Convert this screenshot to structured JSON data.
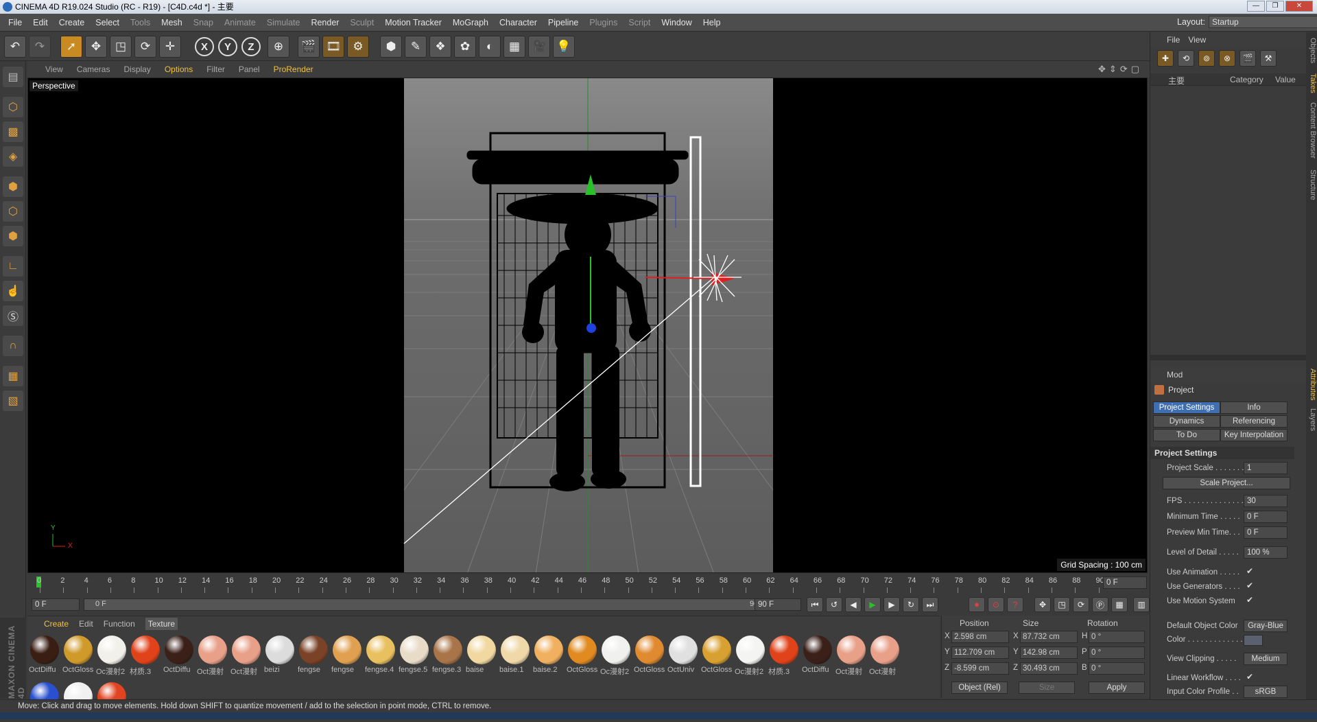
{
  "window": {
    "title": "CINEMA 4D R19.024 Studio (RC - R19) - [C4D.c4d *] - 主要",
    "buttons": [
      "—",
      "❐",
      "✕"
    ]
  },
  "menu": {
    "items": [
      "File",
      "Edit",
      "Create",
      "Select",
      "Tools",
      "Mesh",
      "Snap",
      "Animate",
      "Simulate",
      "Render",
      "Sculpt",
      "Motion Tracker",
      "MoGraph",
      "Character",
      "Pipeline",
      "Plugins",
      "Script",
      "Window",
      "Help"
    ],
    "layout_label": "Layout:",
    "layout_value": "Startup"
  },
  "viewport": {
    "menu": [
      "View",
      "Cameras",
      "Display",
      "Options",
      "Filter",
      "Panel",
      "ProRender"
    ],
    "name": "Perspective",
    "grid_spacing": "Grid Spacing : 100 cm",
    "icons": "✥⇕⟳▢",
    "axis_y": "Y",
    "axis_x": "X"
  },
  "timeline": {
    "ticks": [
      "0",
      "2",
      "4",
      "6",
      "8",
      "10",
      "12",
      "14",
      "16",
      "18",
      "20",
      "22",
      "24",
      "26",
      "28",
      "30",
      "32",
      "34",
      "36",
      "38",
      "40",
      "42",
      "44",
      "46",
      "48",
      "50",
      "52",
      "54",
      "56",
      "58",
      "60",
      "62",
      "64",
      "66",
      "68",
      "70",
      "72",
      "74",
      "76",
      "78",
      "80",
      "82",
      "84",
      "86",
      "88",
      "90"
    ],
    "current_frame": "0 F",
    "start": "0 F",
    "range_start": "0 F",
    "range_end": "90 F",
    "end": "90 F"
  },
  "materials": {
    "menu": [
      "Create",
      "Edit",
      "Function",
      "Texture"
    ],
    "items": [
      {
        "label": "OctDiffu",
        "color": "#3a1e14"
      },
      {
        "label": "OctGloss",
        "color": "#d09a2a"
      },
      {
        "label": "Oc漫射2",
        "color": "#f2f0ea"
      },
      {
        "label": "材质.3",
        "color": "#e0421a"
      },
      {
        "label": "OctDiffu",
        "color": "#3a2018"
      },
      {
        "label": "Oct漫射",
        "color": "#e8a088"
      },
      {
        "label": "Oct漫射",
        "color": "#e8a088"
      },
      {
        "label": "beizi",
        "color": "#dcdcdc"
      },
      {
        "label": "fengse",
        "color": "#7a4226"
      },
      {
        "label": "fengse",
        "color": "#e0a050"
      },
      {
        "label": "fengse.4",
        "color": "#e8c060"
      },
      {
        "label": "fengse.5",
        "color": "#e8dcc8"
      },
      {
        "label": "fengse.3",
        "color": "#a87448"
      },
      {
        "label": "baise",
        "color": "#f0d8a0"
      },
      {
        "label": "baise.1",
        "color": "#f0d8a8"
      },
      {
        "label": "baise.2",
        "color": "#f0b060"
      },
      {
        "label": "OctGloss",
        "color": "#e08a20"
      },
      {
        "label": "Oc漫射2",
        "color": "#f0f0ee"
      },
      {
        "label": "OctGloss",
        "color": "#e08a30"
      },
      {
        "label": "OctUniv",
        "color": "#e0e0e0"
      },
      {
        "label": "OctGloss",
        "color": "#d8a030"
      },
      {
        "label": "Oc漫射2",
        "color": "#f4f4f2"
      },
      {
        "label": "材质.3",
        "color": "#e0421a"
      },
      {
        "label": "OctDiffu",
        "color": "#3a2018"
      },
      {
        "label": "Oct漫射",
        "color": "#e8a088"
      },
      {
        "label": "Oct漫射",
        "color": "#e8a088"
      },
      {
        "label": "",
        "color": "#2a50d0"
      },
      {
        "label": "",
        "color": "#f0f0f0"
      },
      {
        "label": "",
        "color": "#e04420"
      }
    ]
  },
  "coords": {
    "headers": [
      "Position",
      "Size",
      "Rotation"
    ],
    "rows": [
      {
        "axis": "X",
        "pos": "2.598 cm",
        "saxis": "X",
        "size": "87.732 cm",
        "raxis": "H",
        "rot": "0 °"
      },
      {
        "axis": "Y",
        "pos": "112.709 cm",
        "saxis": "Y",
        "size": "142.98 cm",
        "raxis": "P",
        "rot": "0 °"
      },
      {
        "axis": "Z",
        "pos": "-8.599 cm",
        "saxis": "Z",
        "size": "30.493 cm",
        "raxis": "B",
        "rot": "0 °"
      }
    ],
    "mode": "Object (Rel)",
    "size_mode": "Size",
    "apply": "Apply"
  },
  "status": "Move: Click and drag to move elements. Hold down SHIFT to quantize movement / add to the selection in point mode, CTRL to remove.",
  "objects": {
    "menu": [
      "File",
      "View"
    ],
    "columns": [
      "主要",
      "Category",
      "Value"
    ]
  },
  "attributes": {
    "mode": "Mod",
    "title": "Project",
    "tabs": [
      "Project Settings",
      "Info",
      "Dynamics",
      "Referencing",
      "To Do",
      "Key Interpolation"
    ],
    "section": "Project Settings",
    "props": [
      {
        "label": "Project Scale . . . . . . .",
        "value": "1"
      },
      {
        "label": "FPS . . . . . . . . . . . . . . .",
        "value": "30"
      },
      {
        "label": "Minimum Time . . . . .",
        "value": "0 F"
      },
      {
        "label": "Preview Min Time. . .",
        "value": "0 F"
      },
      {
        "label": "Level of Detail . . . . .",
        "value": "100 %"
      }
    ],
    "scale_btn": "Scale Project...",
    "checks": [
      {
        "label": "Use Animation . . . . .",
        "value": "✔"
      },
      {
        "label": "Use Generators . . . .",
        "value": "✔"
      },
      {
        "label": "Use Motion System",
        "value": "✔"
      }
    ],
    "default_color_label": "Default Object Color",
    "default_color": "Gray-Blue",
    "color_label": "Color . . . . . . . . . . . . .",
    "view_clipping": "View Clipping . . . . .",
    "view_clipping_val": "Medium",
    "linear": "Linear Workflow . . . .",
    "linear_val": "✔",
    "input_profile": "Input Color Profile . .",
    "input_profile_val": "sRGB"
  },
  "side_tabs": [
    "Objects",
    "Takes",
    "Content Browser",
    "Structure",
    "Attributes",
    "Layers"
  ],
  "brand": "MAXON CINEMA 4D"
}
